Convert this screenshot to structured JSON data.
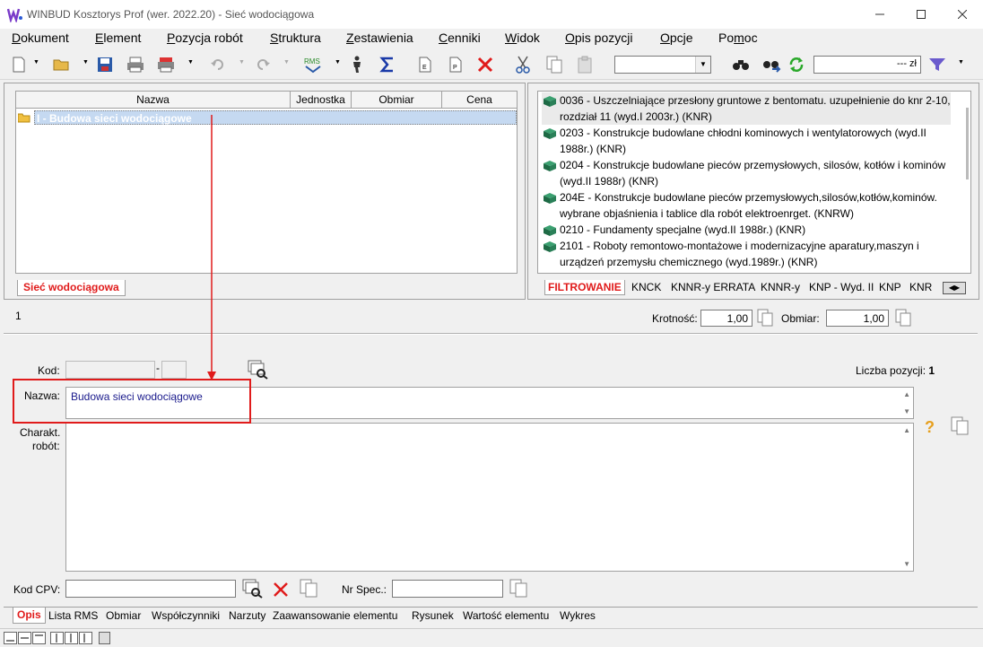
{
  "window": {
    "title": "WINBUD Kosztorys Prof (wer. 2022.20) - Sieć wodociągowa"
  },
  "menu": [
    {
      "label": "Dokument",
      "u": "D",
      "rest": "okument"
    },
    {
      "label": "Element",
      "u": "E",
      "rest": "lement"
    },
    {
      "label": "Pozycja robót",
      "u": "P",
      "rest": "ozycja robót"
    },
    {
      "label": "Struktura",
      "u": "S",
      "rest": "truktura"
    },
    {
      "label": "Zestawienia",
      "u": "Z",
      "rest": "estawienia"
    },
    {
      "label": "Cenniki",
      "u": "C",
      "rest": "enniki"
    },
    {
      "label": "Widok",
      "u": "W",
      "rest": "idok"
    },
    {
      "label": "Opis pozycji",
      "u": "O",
      "rest": "pis pozycji"
    },
    {
      "label": "Opcje",
      "u": "O",
      "rest": "pcje"
    },
    {
      "label": "Pomoc",
      "pre": "Po",
      "u": "m",
      "rest": "oc"
    }
  ],
  "toolbar": {
    "price_unit": "--- zł"
  },
  "tree": {
    "columns": [
      "Nazwa",
      "Jednostka",
      "Obmiar",
      "Cena"
    ],
    "row": "I - Budowa sieci wodociągowe",
    "tab": "Sieć wodociągowa"
  },
  "catalog": {
    "items": [
      "0036 - Uszczelniające przesłony gruntowe z bentomatu. uzupełnienie do knr 2-10, rozdział 11 (wyd.I 2003r.) (KNR)",
      "0203 - Konstrukcje budowlane chłodni kominowych i wentylatorowych (wyd.II 1988r.) (KNR)",
      "0204 - Konstrukcje budowlane pieców przemysłowych, silosów, kotłów i kominów (wyd.II 1988r) (KNR)",
      "204E - Konstrukcje budowlane pieców przemysłowych,silosów,kotłów,kominów. wybrane objaśnienia i tablice dla robót elektroenrget. (KNRW)",
      "0210 - Fundamenty specjalne (wyd.II 1988r.) (KNR)",
      "2101 - Roboty remontowo-montażowe i modernizacyjne aparatury,maszyn i urządzeń przemysłu chemicznego (wyd.1989r.) (KNR)"
    ],
    "tabs": [
      "FILTROWANIE",
      "KNCK",
      "KNNR-y ERRATA",
      "KNNR-y",
      "KNP - Wyd. II",
      "KNP",
      "KNR"
    ]
  },
  "position_counter": "1",
  "krotnosc": {
    "label": "Krotność:",
    "value": "1,00"
  },
  "obmiar": {
    "label": "Obmiar:",
    "value": "1,00"
  },
  "form": {
    "kod_label": "Kod:",
    "kod_sep": "-",
    "liczba_label": "Liczba pozycji:",
    "liczba_value": "1",
    "nazwa_label": "Nazwa:",
    "nazwa_value": "Budowa sieci wodociągowe",
    "charakt_label1": "Charakt.",
    "charakt_label2": "robót:",
    "kodcpv_label": "Kod CPV:",
    "nrspec_label": "Nr Spec.:"
  },
  "bottom_tabs": [
    "Opis",
    "Lista RMS",
    "Obmiar",
    "Współczynniki",
    "Narzuty",
    "Zaawansowanie elementu",
    "Rysunek",
    "Wartość elementu",
    "Wykres"
  ],
  "colors": {
    "accent_red": "#e01b1b",
    "selection": "#c5d9f1",
    "link_blue": "#1a1a8c"
  }
}
